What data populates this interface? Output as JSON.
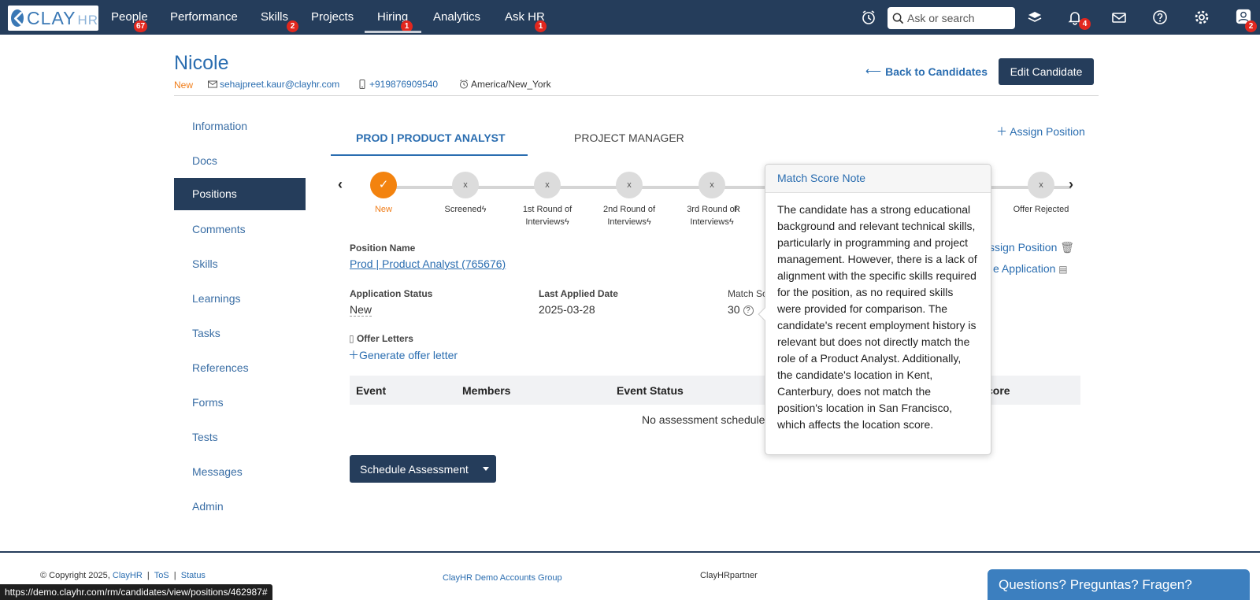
{
  "nav": {
    "logo_text": "CLAY",
    "logo_hr": "HR",
    "items": [
      {
        "label": "People",
        "badge": "67"
      },
      {
        "label": "Performance",
        "badge": ""
      },
      {
        "label": "Skills",
        "badge": "2"
      },
      {
        "label": "Projects",
        "badge": ""
      },
      {
        "label": "Hiring",
        "badge": "1"
      },
      {
        "label": "Analytics",
        "badge": ""
      },
      {
        "label": "Ask HR",
        "badge": "1"
      }
    ],
    "search_placeholder": "Ask or search",
    "notifications_badge": "4",
    "profile_badge": "2",
    "icons": [
      "alarm-clock-icon",
      "layers-icon",
      "bell-icon",
      "mail-icon",
      "help-icon",
      "gear-icon",
      "user-icon"
    ]
  },
  "candidate": {
    "name": "Nicole",
    "status": "New",
    "email": "sehajpreet.kaur@clayhr.com",
    "phone": "+919876909540",
    "timezone": "America/New_York"
  },
  "header": {
    "back_label": "Back to Candidates",
    "edit_label": "Edit Candidate"
  },
  "sidebar": {
    "items": [
      "Information",
      "Docs",
      "Positions",
      "Comments",
      "Skills",
      "Learnings",
      "Tasks",
      "References",
      "Forms",
      "Tests",
      "Messages",
      "Admin"
    ],
    "active": "Positions"
  },
  "tabs": {
    "active": "PROD | PRODUCT ANALYST",
    "inactive": "PROJECT MANAGER",
    "assign_label": "Assign Position"
  },
  "stepper": {
    "steps": [
      {
        "label": "New",
        "mark": "✓",
        "done": true
      },
      {
        "label": "Screened",
        "mark": "x",
        "done": false
      },
      {
        "label": "1st Round of Interviews",
        "mark": "x",
        "done": false
      },
      {
        "label": "2nd Round of Interviews",
        "mark": "x",
        "done": false
      },
      {
        "label": "3rd Round of Interviews",
        "mark": "x",
        "done": false
      },
      {
        "label": "R",
        "mark": "",
        "done": false
      },
      {
        "label": "Offer Rejected",
        "mark": "x",
        "done": false
      }
    ]
  },
  "position": {
    "name_label": "Position Name",
    "name_value": "Prod | Product Analyst (765676)",
    "app_status_label": "Application Status",
    "app_status_value": "New",
    "last_applied_label": "Last Applied Date",
    "last_applied_value": "2025-03-28",
    "match_score_label": "Match Sc",
    "match_score_value": "30",
    "offer_letters_label": "Offer Letters",
    "generate_offer_label": "Generate offer letter",
    "unassign_label": "ssign Position",
    "archive_label": "e Application"
  },
  "table": {
    "columns": [
      "Event",
      "Members",
      "Event Status",
      "core"
    ],
    "empty_text": "No assessment schedule"
  },
  "schedule_label": "Schedule Assessment",
  "popover": {
    "title": "Match Score Note",
    "body": "The candidate has a strong educational background and relevant technical skills, particularly in programming and project management. However, there is a lack of alignment with the specific skills required for the position, as no required skills were provided for comparison. The candidate's recent employment history is relevant but does not directly match the role of a Product Analyst. Additionally, the candidate's location in Kent, Canterbury, does not match the position's location in San Francisco, which affects the location score."
  },
  "footer": {
    "copyright": "© Copyright 2025,",
    "clayhr": "ClayHR",
    "tos": "ToS",
    "status": "Status",
    "group": "ClayHR Demo Accounts Group",
    "partner": "ClayHRpartner",
    "status_url": "https://demo.clayhr.com/rm/candidates/view/positions/462987#",
    "chat": "Questions? Preguntas? Fragen?"
  },
  "colors": {
    "nav_bg": "#253d5b",
    "link": "#2a6db0",
    "accent_orange": "#f3830f",
    "badge_red": "#e2271e"
  }
}
